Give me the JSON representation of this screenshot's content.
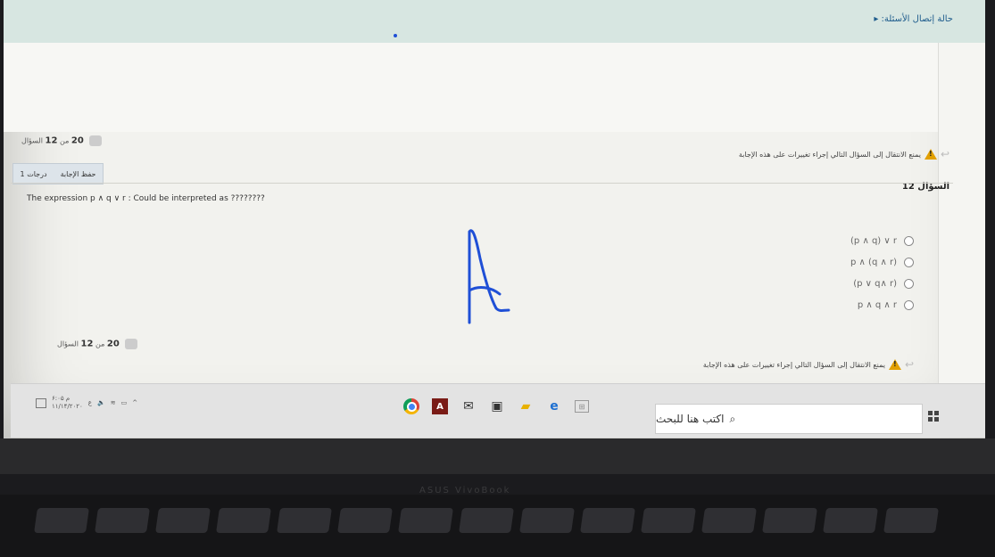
{
  "header": {
    "status_link": "حالة إتصال الأسئلة:"
  },
  "navigation": {
    "counter_top": {
      "label": "السؤال",
      "current": "12",
      "of": "من",
      "total": "20"
    },
    "counter_bottom": {
      "label": "السؤال",
      "current": "12",
      "of": "من",
      "total": "20"
    },
    "warning_top": "يمنع الانتقال إلى السؤال التالي إجراء تغييرات على هذه الإجابة",
    "warning_bottom": "يمنع الانتقال إلى السؤال التالي إجراء تغييرات على هذه الإجابة"
  },
  "question": {
    "title": "السؤال 12",
    "points": "1 درجات",
    "flag_label": "حفظ الإجابة",
    "text": "The expression p ∧ q ∨ r : Could be interpreted as ????????",
    "options": [
      "(p ∧ q) ∨ r",
      "p ∧ (q ∧ r)",
      "(p ∨ q∧ r)",
      "p ∧ q ∧ r"
    ]
  },
  "annotation": {
    "handwritten_letter": "A",
    "ink_color": "#1f4fd6"
  },
  "taskbar": {
    "search_placeholder": "اكتب هنا للبحث",
    "clock_time": "۶:۰۵ م",
    "clock_date": "۱۱/۱۴/۲۰۲۰",
    "apps": [
      "chrome-icon",
      "acrobat-icon",
      "mail-icon",
      "store-icon",
      "file-explorer-icon",
      "edge-icon"
    ]
  },
  "device": {
    "brand": "ASUS VivoBook"
  }
}
